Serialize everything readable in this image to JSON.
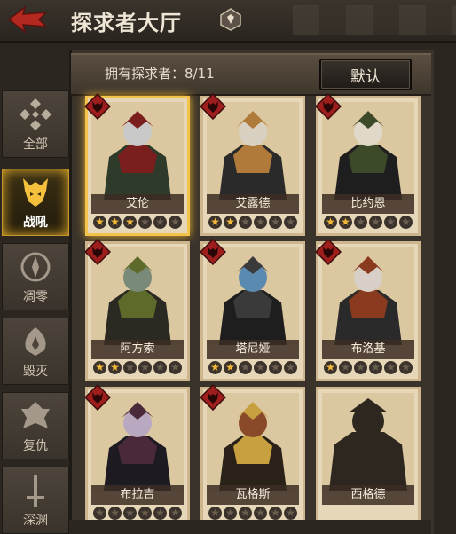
{
  "header": {
    "title": "探求者大厅"
  },
  "toolbar": {
    "owned_text": "拥有探求者：8/11",
    "default_label": "默认"
  },
  "sidebar": {
    "tabs": [
      {
        "label": "全部",
        "icon": "all-diamond-icon",
        "active": false
      },
      {
        "label": "战吼",
        "icon": "warcry-demon-icon",
        "active": true
      },
      {
        "label": "凋零",
        "icon": "wither-icon",
        "active": false
      },
      {
        "label": "毁灭",
        "icon": "destruction-icon",
        "active": false
      },
      {
        "label": "复仇",
        "icon": "revenge-icon",
        "active": false
      },
      {
        "label": "深渊",
        "icon": "abyss-sword-icon",
        "active": false
      }
    ]
  },
  "colors": {
    "accent": "#f3c34a",
    "badge": "#9e1d1d",
    "star_on": "#f3b73a"
  },
  "cards": [
    {
      "name": "艾伦",
      "stars": 3,
      "unlocked": true,
      "selected": true
    },
    {
      "name": "艾露德",
      "stars": 2,
      "unlocked": true,
      "selected": false
    },
    {
      "name": "比约恩",
      "stars": 2,
      "unlocked": true,
      "selected": false
    },
    {
      "name": "阿方索",
      "stars": 2,
      "unlocked": true,
      "selected": false
    },
    {
      "name": "塔尼娅",
      "stars": 2,
      "unlocked": true,
      "selected": false
    },
    {
      "name": "布洛基",
      "stars": 1,
      "unlocked": true,
      "selected": false
    },
    {
      "name": "布拉吉",
      "stars": 0,
      "unlocked": true,
      "selected": false
    },
    {
      "name": "瓦格斯",
      "stars": 0,
      "unlocked": true,
      "selected": false
    },
    {
      "name": "西格德",
      "stars": 0,
      "unlocked": false,
      "selected": false
    }
  ]
}
